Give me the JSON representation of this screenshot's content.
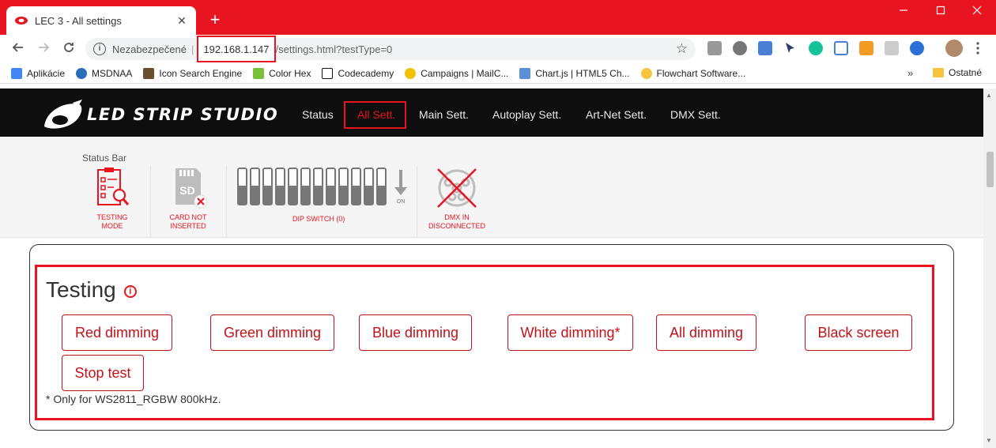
{
  "browser": {
    "tab_title": "LEC 3 - All settings",
    "tab_close": "✕",
    "new_tab": "+",
    "security_label": "Nezabezpečené",
    "host": "192.168.1.147",
    "path": "/settings.html?testType=0",
    "bookmarks": [
      {
        "label": "Aplikácie",
        "color": "#4285f4"
      },
      {
        "label": "MSDNAA",
        "color": "#2a6ebb"
      },
      {
        "label": "Icon Search Engine",
        "color": "#6b4e2e"
      },
      {
        "label": "Color Hex",
        "color": "#7cbf3a"
      },
      {
        "label": "Codecademy",
        "color": "#111111"
      },
      {
        "label": "Campaigns | MailC...",
        "color": "#f2c200"
      },
      {
        "label": "Chart.js | HTML5 Ch...",
        "color": "#5b8fd6"
      },
      {
        "label": "Flowchart Software...",
        "color": "#f5c542"
      }
    ],
    "bookmarks_more": "»",
    "other_bookmarks": "Ostatné"
  },
  "header": {
    "brand": "LED STRIP STUDIO",
    "nav": [
      {
        "label": "Status",
        "active": false
      },
      {
        "label": "All Sett.",
        "active": true
      },
      {
        "label": "Main Sett.",
        "active": false
      },
      {
        "label": "Autoplay Sett.",
        "active": false
      },
      {
        "label": "Art-Net Sett.",
        "active": false
      },
      {
        "label": "DMX Sett.",
        "active": false
      }
    ]
  },
  "status_bar": {
    "title": "Status Bar",
    "testing_mode": [
      "TESTING",
      "MODE"
    ],
    "card": [
      "CARD NOT",
      "INSERTED"
    ],
    "card_icon_text": "SD",
    "dip_switch": "DIP SWITCH (0)",
    "dip_on": "ON",
    "dmx": [
      "DMX IN",
      "DISCONNECTED"
    ]
  },
  "testing": {
    "title": "Testing",
    "buttons": [
      "Red dimming",
      "Green dimming",
      "Blue dimming",
      "White dimming*",
      "All dimming",
      "Black screen",
      "Stop test"
    ],
    "footnote": "* Only for WS2811_RGBW 800kHz."
  },
  "colors": {
    "accent": "#e8141f",
    "nav_bg": "#0e0e0e",
    "button_text": "#c1121a"
  }
}
